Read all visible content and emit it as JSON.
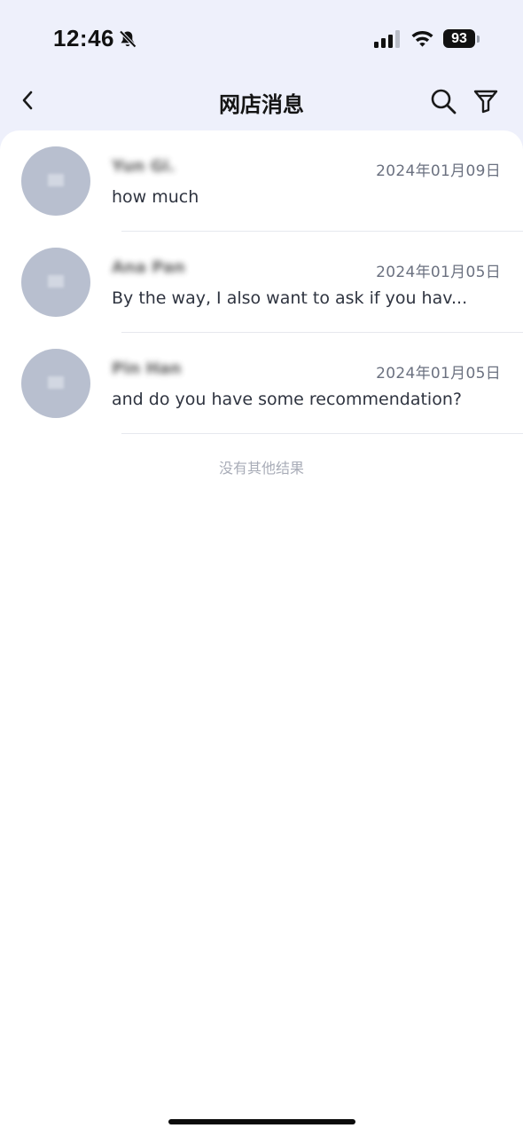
{
  "status_bar": {
    "time": "12:46",
    "battery": "93",
    "icons": [
      "bell-slash-icon",
      "signal-icon",
      "wifi-icon",
      "battery-icon"
    ]
  },
  "nav": {
    "title": "网店消息",
    "icons": [
      "chevron-left-icon",
      "search-icon",
      "filter-icon"
    ]
  },
  "conversations": [
    {
      "name": "Yun Gi.",
      "date": "2024年01月09日",
      "preview": "how much"
    },
    {
      "name": "Ana Pan",
      "date": "2024年01月05日",
      "preview": "By the way, I also want to ask if you hav..."
    },
    {
      "name": "Pin Han",
      "date": "2024年01月05日",
      "preview": "and do you have some recommendation?"
    }
  ],
  "end_of_results": "没有其他结果",
  "colors": {
    "header_background": "#eef0fb",
    "avatar_placeholder": "#b8bfcf",
    "date_text": "#6b7180",
    "footer_text": "#a9adb8"
  }
}
